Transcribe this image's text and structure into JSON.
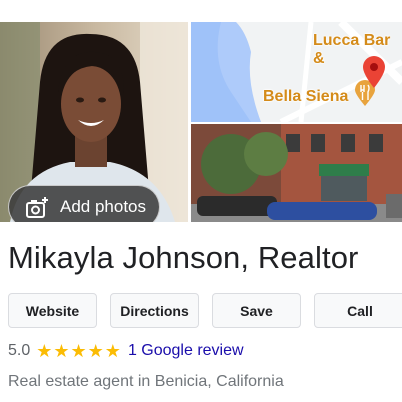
{
  "photos": {
    "add_photos_label": "Add photos",
    "map_labels": {
      "top": "Lucca Bar &",
      "middle": "Bella Siena"
    }
  },
  "business": {
    "name": "Mikayla Johnson, Realtor",
    "category": "Real estate agent in Benicia, California"
  },
  "actions": {
    "website": "Website",
    "directions": "Directions",
    "save": "Save",
    "call": "Call"
  },
  "rating": {
    "value": "5.0",
    "stars": "★★★★★",
    "review_link": "1 Google review"
  },
  "colors": {
    "star": "#fbbc04",
    "link": "#1a0dab",
    "map_water": "#aecbfa",
    "map_pin": "#ea4335",
    "poi": "#d48b1a"
  }
}
